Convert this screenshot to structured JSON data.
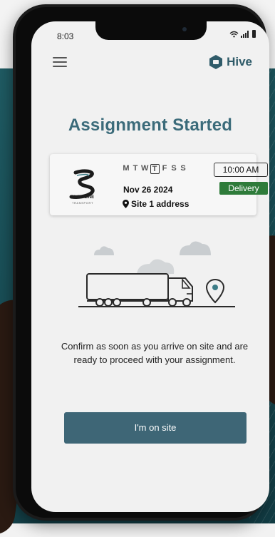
{
  "status_bar": {
    "time": "8:03",
    "icons": [
      "wifi-icon",
      "signal-icon",
      "battery-icon"
    ]
  },
  "header": {
    "menu_icon": "menu-icon",
    "brand_name": "Hive",
    "brand_icon": "hive-hex-icon"
  },
  "page": {
    "title": "Assignment Started"
  },
  "assignment": {
    "company_logo_text": "SWIFTLINE",
    "company_logo_sub": "TRANSPORT",
    "days": [
      "M",
      "T",
      "W",
      "T",
      "F",
      "S",
      "S"
    ],
    "selected_day_index": 3,
    "time": "10:00 AM",
    "date": "Nov 26 2024",
    "type_badge": "Delivery",
    "address": "Site 1 address",
    "address_icon": "map-pin-icon"
  },
  "illustration": "truck-with-location-pin",
  "message": "Confirm as soon as you arrive on site and are ready to proceed with your assignment.",
  "cta": {
    "label": "I'm on site"
  },
  "colors": {
    "brand": "#3b6b7a",
    "cta_bg": "#3e6676",
    "badge_green": "#2e7b3a",
    "background_teal": "#1f5b63"
  }
}
